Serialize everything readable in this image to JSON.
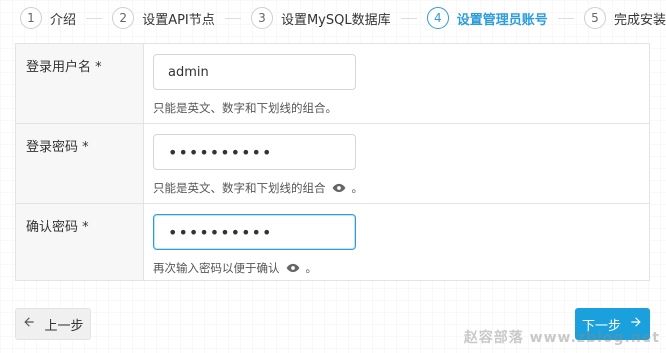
{
  "steps": [
    {
      "num": "1",
      "label": "介绍"
    },
    {
      "num": "2",
      "label": "设置API节点"
    },
    {
      "num": "3",
      "label": "设置MySQL数据库"
    },
    {
      "num": "4",
      "label": "设置管理员账号",
      "active": true
    },
    {
      "num": "5",
      "label": "完成安装"
    }
  ],
  "form": {
    "username": {
      "label": "登录用户名 *",
      "value": "admin",
      "help": "只能是英文、数字和下划线的组合。"
    },
    "password": {
      "label": "登录密码 *",
      "value": "••••••••••",
      "help_prefix": "只能是英文、数字和下划线的组合",
      "help_suffix": "。",
      "icon": "eye-icon"
    },
    "confirm": {
      "label": "确认密码 *",
      "value": "••••••••••",
      "help_prefix": "再次输入密码以便于确认",
      "help_suffix": "。",
      "icon": "eye-icon"
    }
  },
  "buttons": {
    "prev_label": "上一步",
    "next_label": "下一步"
  },
  "watermark": "赵容部落 www.zblog.net",
  "colors": {
    "accent": "#1aa0dc",
    "active_step": "#2d9cdb"
  }
}
